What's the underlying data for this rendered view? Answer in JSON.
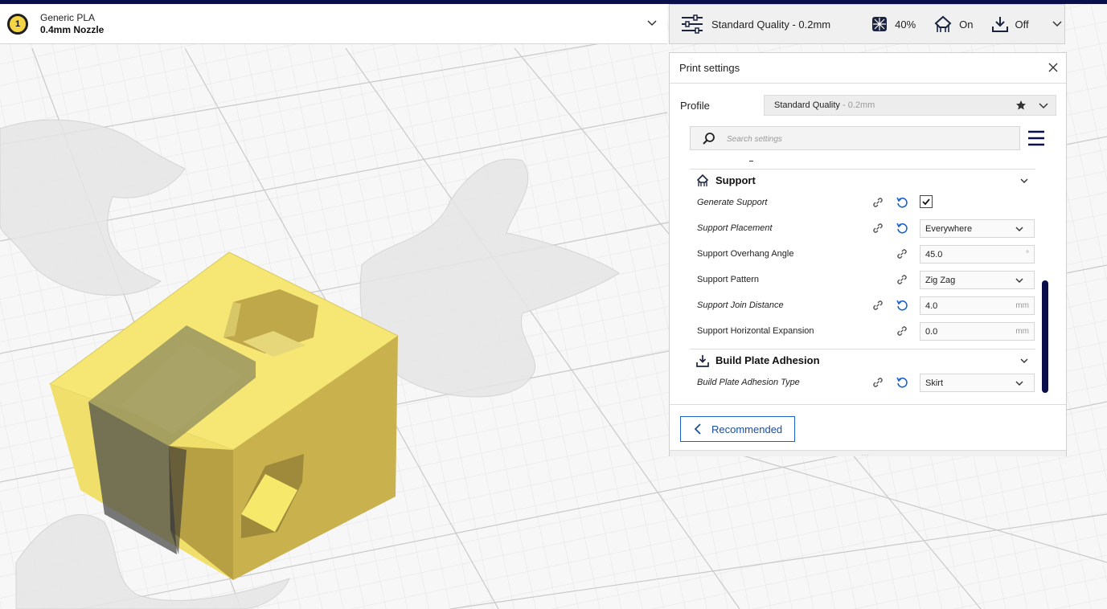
{
  "material": {
    "extruder_number": "1",
    "name": "Generic PLA",
    "nozzle": "0.4mm Nozzle"
  },
  "header": {
    "profile": "Standard Quality - 0.2mm",
    "infill": "40%",
    "support": "On",
    "adhesion": "Off"
  },
  "panel": {
    "title": "Print settings",
    "profile_label": "Profile",
    "profile_value": "Standard Quality",
    "profile_sub": " - 0.2mm",
    "search_placeholder": "Search settings",
    "dash": "-",
    "support_category": "Support",
    "adhesion_category": "Build Plate Adhesion",
    "rows": [
      {
        "label": "Generate Support",
        "value": ""
      },
      {
        "label": "Support Placement",
        "value": "Everywhere"
      },
      {
        "label": "Support Overhang Angle",
        "value": "45.0",
        "unit": "°"
      },
      {
        "label": "Support Pattern",
        "value": "Zig Zag"
      },
      {
        "label": "Support Join Distance",
        "value": "4.0",
        "unit": "mm"
      },
      {
        "label": "Support Horizontal Expansion",
        "value": "0.0",
        "unit": "mm"
      },
      {
        "label": "Build Plate Adhesion Type",
        "value": "Skirt"
      }
    ],
    "recommended_label": "Recommended"
  },
  "colors": {
    "accent": "#1a63c9",
    "top_bar": "#0a0e4a",
    "model_top": "#f6e774",
    "model_side": "#bda64b"
  }
}
